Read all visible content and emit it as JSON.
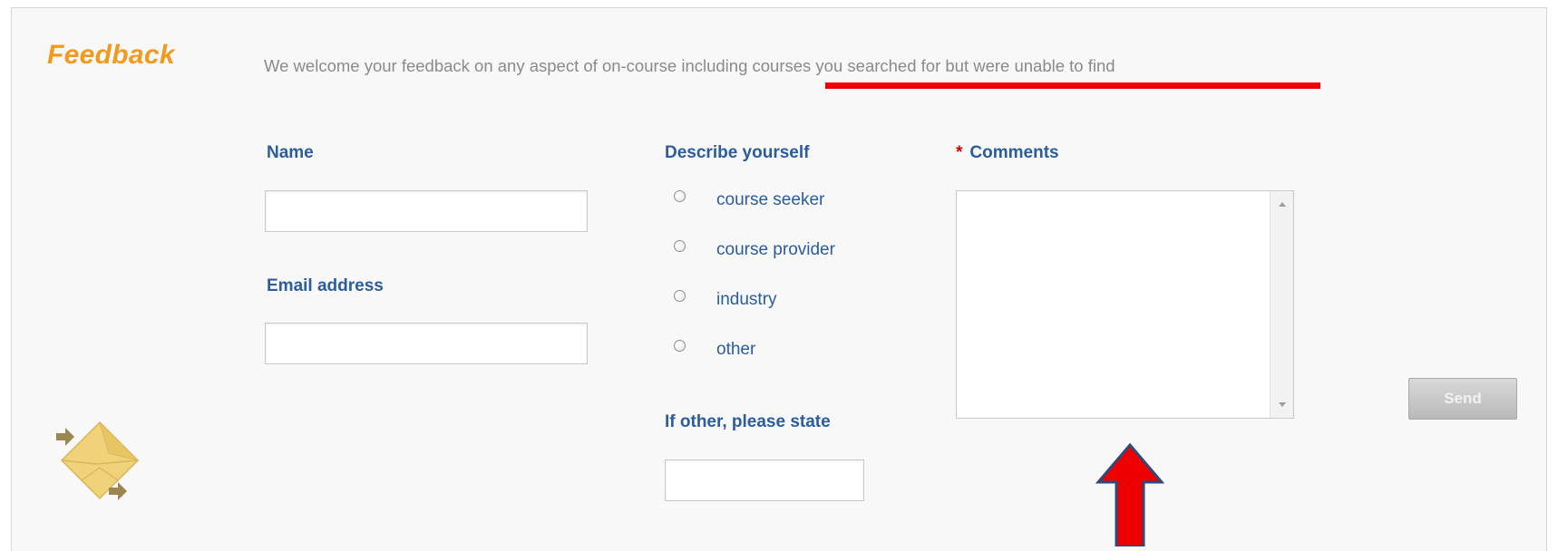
{
  "feedback": {
    "title": "Feedback",
    "intro": "We welcome your feedback on any aspect of on-course including courses you searched for but were unable to find"
  },
  "form": {
    "name_label": "Name",
    "name_value": "",
    "email_label": "Email address",
    "email_value": "",
    "describe_label": "Describe yourself",
    "describe_options": [
      {
        "label": "course seeker",
        "selected": false
      },
      {
        "label": "course provider",
        "selected": false
      },
      {
        "label": "industry",
        "selected": false
      },
      {
        "label": "other",
        "selected": false
      }
    ],
    "other_label": "If other, please state",
    "other_value": "",
    "comments_required_mark": "*",
    "comments_label": "Comments",
    "comments_value": "",
    "send_label": "Send"
  },
  "icons": {
    "envelope": "envelope-arrows-icon",
    "annotation_arrow": "up-arrow-annotation"
  },
  "colors": {
    "title": "#f39a1e",
    "label": "#2b5c9e",
    "intro_text": "#8a8a8a",
    "required": "#d60000",
    "annotation_red": "#ee0000",
    "annotation_outline": "#2e4a78",
    "envelope": "#f0d27a"
  }
}
